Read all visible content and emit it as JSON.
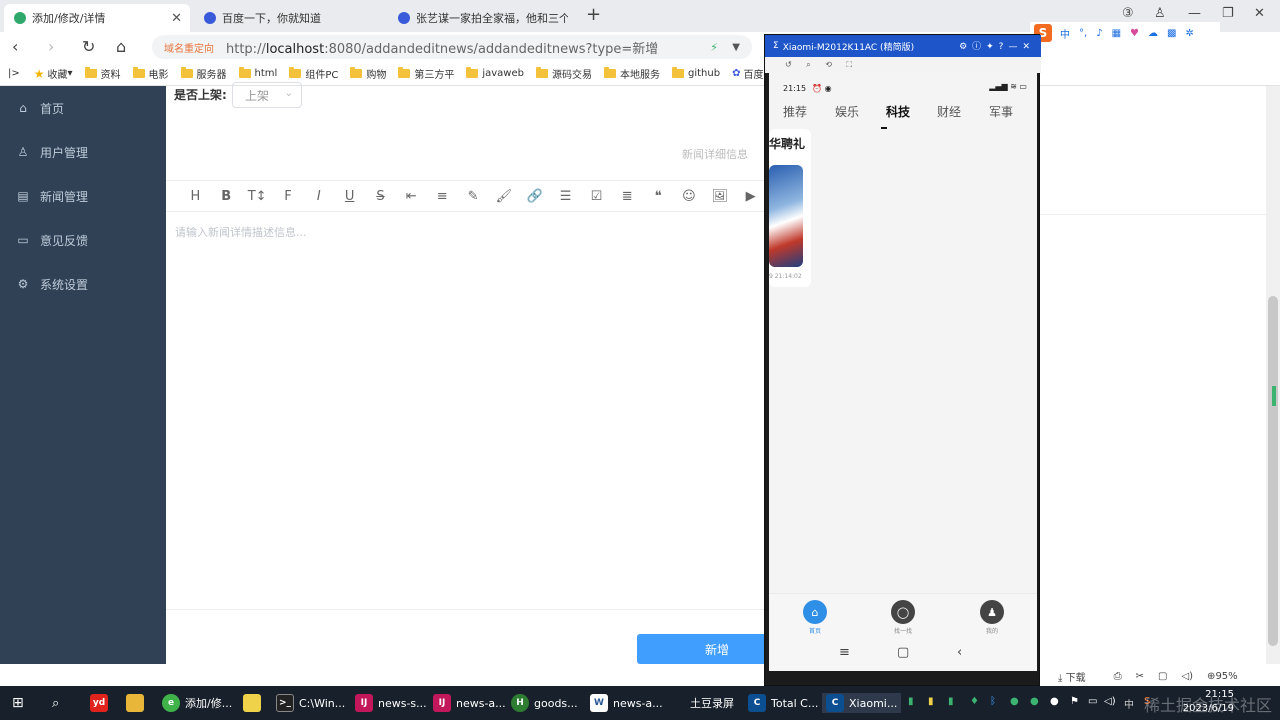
{
  "browser": {
    "tabs": [
      {
        "label": "添加/修改/详情",
        "active": true
      },
      {
        "label": "百度一下，你就知道",
        "active": false
      },
      {
        "label": "张艺谋一家拍全家福，他和三个",
        "active": false
      }
    ],
    "new_tab": "+",
    "redirect_label": "域名重定向",
    "url_prefix": "http://",
    "url_host": "localhost",
    "url_rest": ":8080/addandeditnews/addandeditnews?type=新增",
    "bookmarks": [
      "收藏",
      "资料",
      "电影",
      "服务器",
      "html",
      "组件PC",
      "购物",
      "第三方平",
      "javaweb",
      "源码交易",
      "本地服务",
      "github",
      "百度一"
    ],
    "status": {
      "download": "下载",
      "zoom": "95%"
    }
  },
  "sidebar": {
    "items": [
      {
        "label": "首页",
        "icon": "home-icon"
      },
      {
        "label": "用户管理",
        "icon": "user-icon"
      },
      {
        "label": "新闻管理",
        "icon": "document-icon"
      },
      {
        "label": "意见反馈",
        "icon": "message-icon"
      },
      {
        "label": "系统设置",
        "icon": "gear-icon"
      }
    ]
  },
  "form": {
    "status_label": "是否上架:",
    "status_value": "上架",
    "detail_hint": "新闻详细信息",
    "toolbar": [
      "H",
      "B",
      "T↕",
      "F",
      "I",
      "U",
      "S",
      "⇤",
      "≡",
      "✎",
      "🖌",
      "🔗",
      "☰",
      "☑",
      "≣",
      "❝",
      "☺",
      "🖼",
      "▶"
    ],
    "editor_placeholder": "请输入新闻详情描述信息...",
    "submit": "新增"
  },
  "phone": {
    "window_title": "Xiaomi-M2012K11AC (精简版)",
    "time": "21:15",
    "tabs": [
      "推荐",
      "娱乐",
      "科技",
      "财经",
      "军事"
    ],
    "active_tab": "科技",
    "news_title": "华聘礼",
    "news_time": "9 21:14:02",
    "nav": [
      {
        "label": "首页",
        "icon": "home-icon",
        "color": "#2f8ee6"
      },
      {
        "label": "找一找",
        "icon": "search-icon",
        "color": "#444"
      },
      {
        "label": "我的",
        "icon": "user-icon",
        "color": "#444"
      }
    ],
    "sysnav": [
      "≡",
      "▢",
      "‹"
    ]
  },
  "ime": {
    "logo": "S",
    "mode": "中"
  },
  "taskbar": {
    "items": [
      "添加/修...",
      "C:\\Win...",
      "news-s...",
      "news-a...",
      "goods...",
      "news-a...",
      "土豆录屏",
      "Total C...",
      "Xiaomi..."
    ],
    "time": "21:15",
    "date": "2023/6/19",
    "watermark": "稀土掘金技术社区"
  },
  "colors": {
    "sidebar": "#304156",
    "primary": "#409eff",
    "phone_title": "#1e56c9",
    "taskbar": "#18202b"
  }
}
